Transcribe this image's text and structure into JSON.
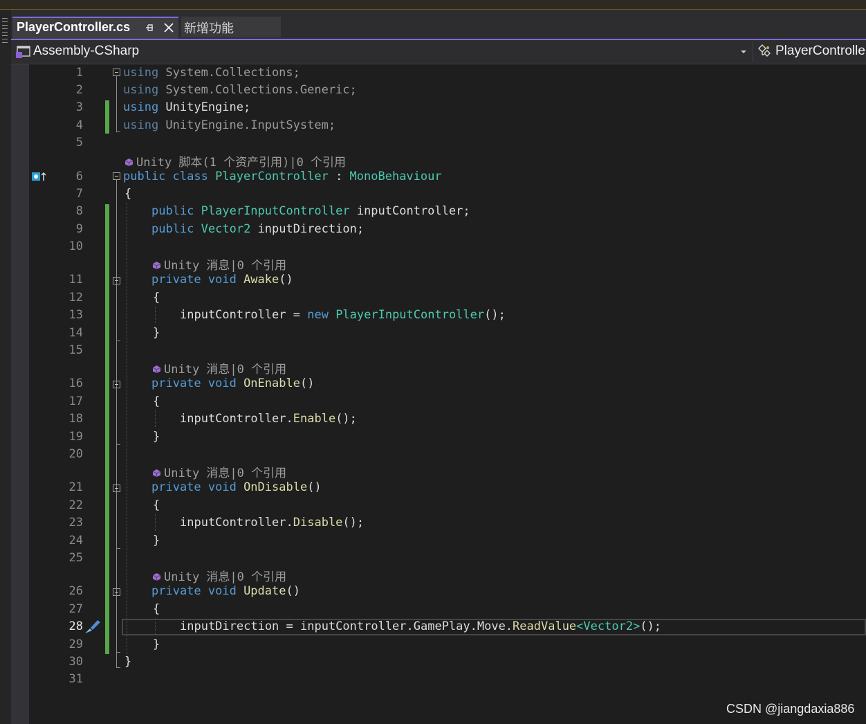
{
  "tabs": {
    "active": "PlayerController.cs",
    "inactive": "新增功能"
  },
  "navbar": {
    "project": "Assembly-CSharp",
    "class_scope": "PlayerControlle"
  },
  "codelens": {
    "class_lens": "Unity 脚本(1 个资产引用)|0 个引用",
    "method_lens": "Unity 消息|0 个引用"
  },
  "watermark": "CSDN @jiangdaxia886",
  "colors": {
    "keyword": "#569cd6",
    "type": "#4ec9b0",
    "method": "#dcdcaa",
    "change_bar": "#57a64a",
    "tab_accent": "#7d6bd6"
  },
  "line_numbers": [
    "1",
    "2",
    "3",
    "4",
    "5",
    "6",
    "7",
    "8",
    "9",
    "10",
    "11",
    "12",
    "13",
    "14",
    "15",
    "16",
    "17",
    "18",
    "19",
    "20",
    "21",
    "22",
    "23",
    "24",
    "25",
    "26",
    "27",
    "28",
    "29",
    "30",
    "31"
  ],
  "current_line": "28",
  "code": {
    "l1": {
      "kw": "using",
      "rest": " System.Collections;"
    },
    "l2": {
      "kw": "using",
      "rest": " System.Collections.Generic;"
    },
    "l3": {
      "kw": "using",
      "rest": " UnityEngine;"
    },
    "l4": {
      "kw": "using",
      "rest": " UnityEngine.InputSystem;"
    },
    "l6": {
      "kw": "public class",
      "name": " PlayerController",
      "colon": " : ",
      "base": "MonoBehaviour"
    },
    "l7": {
      "text": "{"
    },
    "l8": {
      "kw": "public",
      "type": " PlayerInputController",
      "rest": " inputController;"
    },
    "l9": {
      "kw": "public",
      "type": " Vector2",
      "rest": " inputDirection;"
    },
    "l11": {
      "kw": "private void",
      "name": " Awake",
      "rest": "()"
    },
    "l12": {
      "text": "{"
    },
    "l13": {
      "a": "inputController = ",
      "kw": "new",
      "type": " PlayerInputController",
      "rest": "();"
    },
    "l14": {
      "text": "}"
    },
    "l16": {
      "kw": "private void",
      "name": " OnEnable",
      "rest": "()"
    },
    "l17": {
      "text": "{"
    },
    "l18": {
      "a": "inputController.",
      "method": "Enable",
      "rest": "();"
    },
    "l19": {
      "text": "}"
    },
    "l21": {
      "kw": "private void",
      "name": " OnDisable",
      "rest": "()"
    },
    "l22": {
      "text": "{"
    },
    "l23": {
      "a": "inputController.",
      "method": "Disable",
      "rest": "();"
    },
    "l24": {
      "text": "}"
    },
    "l26": {
      "kw": "private void",
      "name": " Update",
      "rest": "()"
    },
    "l27": {
      "text": "{"
    },
    "l28": {
      "a": "inputDirection = inputController.GamePlay.Move.",
      "method": "ReadValue",
      "lt": "<",
      "type": "Vector2",
      "gt": ">",
      "rest": "();"
    },
    "l29": {
      "text": "}"
    },
    "l30": {
      "text": "}"
    }
  }
}
